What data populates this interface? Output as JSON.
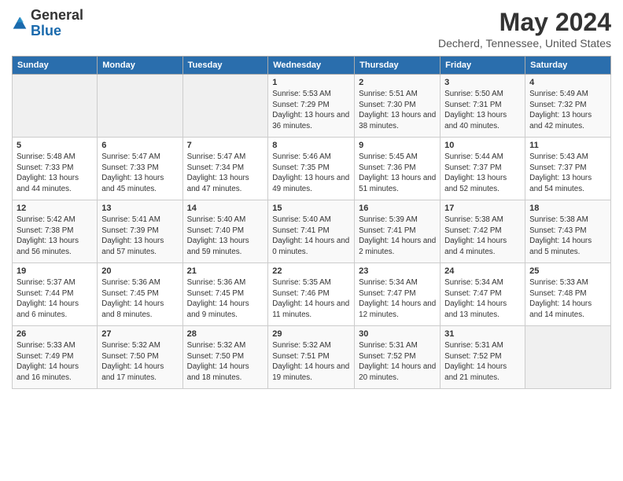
{
  "logo": {
    "general": "General",
    "blue": "Blue"
  },
  "header": {
    "month": "May 2024",
    "location": "Decherd, Tennessee, United States"
  },
  "days_of_week": [
    "Sunday",
    "Monday",
    "Tuesday",
    "Wednesday",
    "Thursday",
    "Friday",
    "Saturday"
  ],
  "weeks": [
    [
      {
        "day": "",
        "sunrise": "",
        "sunset": "",
        "daylight": ""
      },
      {
        "day": "",
        "sunrise": "",
        "sunset": "",
        "daylight": ""
      },
      {
        "day": "",
        "sunrise": "",
        "sunset": "",
        "daylight": ""
      },
      {
        "day": "1",
        "sunrise": "Sunrise: 5:53 AM",
        "sunset": "Sunset: 7:29 PM",
        "daylight": "Daylight: 13 hours and 36 minutes."
      },
      {
        "day": "2",
        "sunrise": "Sunrise: 5:51 AM",
        "sunset": "Sunset: 7:30 PM",
        "daylight": "Daylight: 13 hours and 38 minutes."
      },
      {
        "day": "3",
        "sunrise": "Sunrise: 5:50 AM",
        "sunset": "Sunset: 7:31 PM",
        "daylight": "Daylight: 13 hours and 40 minutes."
      },
      {
        "day": "4",
        "sunrise": "Sunrise: 5:49 AM",
        "sunset": "Sunset: 7:32 PM",
        "daylight": "Daylight: 13 hours and 42 minutes."
      }
    ],
    [
      {
        "day": "5",
        "sunrise": "Sunrise: 5:48 AM",
        "sunset": "Sunset: 7:33 PM",
        "daylight": "Daylight: 13 hours and 44 minutes."
      },
      {
        "day": "6",
        "sunrise": "Sunrise: 5:47 AM",
        "sunset": "Sunset: 7:33 PM",
        "daylight": "Daylight: 13 hours and 45 minutes."
      },
      {
        "day": "7",
        "sunrise": "Sunrise: 5:47 AM",
        "sunset": "Sunset: 7:34 PM",
        "daylight": "Daylight: 13 hours and 47 minutes."
      },
      {
        "day": "8",
        "sunrise": "Sunrise: 5:46 AM",
        "sunset": "Sunset: 7:35 PM",
        "daylight": "Daylight: 13 hours and 49 minutes."
      },
      {
        "day": "9",
        "sunrise": "Sunrise: 5:45 AM",
        "sunset": "Sunset: 7:36 PM",
        "daylight": "Daylight: 13 hours and 51 minutes."
      },
      {
        "day": "10",
        "sunrise": "Sunrise: 5:44 AM",
        "sunset": "Sunset: 7:37 PM",
        "daylight": "Daylight: 13 hours and 52 minutes."
      },
      {
        "day": "11",
        "sunrise": "Sunrise: 5:43 AM",
        "sunset": "Sunset: 7:37 PM",
        "daylight": "Daylight: 13 hours and 54 minutes."
      }
    ],
    [
      {
        "day": "12",
        "sunrise": "Sunrise: 5:42 AM",
        "sunset": "Sunset: 7:38 PM",
        "daylight": "Daylight: 13 hours and 56 minutes."
      },
      {
        "day": "13",
        "sunrise": "Sunrise: 5:41 AM",
        "sunset": "Sunset: 7:39 PM",
        "daylight": "Daylight: 13 hours and 57 minutes."
      },
      {
        "day": "14",
        "sunrise": "Sunrise: 5:40 AM",
        "sunset": "Sunset: 7:40 PM",
        "daylight": "Daylight: 13 hours and 59 minutes."
      },
      {
        "day": "15",
        "sunrise": "Sunrise: 5:40 AM",
        "sunset": "Sunset: 7:41 PM",
        "daylight": "Daylight: 14 hours and 0 minutes."
      },
      {
        "day": "16",
        "sunrise": "Sunrise: 5:39 AM",
        "sunset": "Sunset: 7:41 PM",
        "daylight": "Daylight: 14 hours and 2 minutes."
      },
      {
        "day": "17",
        "sunrise": "Sunrise: 5:38 AM",
        "sunset": "Sunset: 7:42 PM",
        "daylight": "Daylight: 14 hours and 4 minutes."
      },
      {
        "day": "18",
        "sunrise": "Sunrise: 5:38 AM",
        "sunset": "Sunset: 7:43 PM",
        "daylight": "Daylight: 14 hours and 5 minutes."
      }
    ],
    [
      {
        "day": "19",
        "sunrise": "Sunrise: 5:37 AM",
        "sunset": "Sunset: 7:44 PM",
        "daylight": "Daylight: 14 hours and 6 minutes."
      },
      {
        "day": "20",
        "sunrise": "Sunrise: 5:36 AM",
        "sunset": "Sunset: 7:45 PM",
        "daylight": "Daylight: 14 hours and 8 minutes."
      },
      {
        "day": "21",
        "sunrise": "Sunrise: 5:36 AM",
        "sunset": "Sunset: 7:45 PM",
        "daylight": "Daylight: 14 hours and 9 minutes."
      },
      {
        "day": "22",
        "sunrise": "Sunrise: 5:35 AM",
        "sunset": "Sunset: 7:46 PM",
        "daylight": "Daylight: 14 hours and 11 minutes."
      },
      {
        "day": "23",
        "sunrise": "Sunrise: 5:34 AM",
        "sunset": "Sunset: 7:47 PM",
        "daylight": "Daylight: 14 hours and 12 minutes."
      },
      {
        "day": "24",
        "sunrise": "Sunrise: 5:34 AM",
        "sunset": "Sunset: 7:47 PM",
        "daylight": "Daylight: 14 hours and 13 minutes."
      },
      {
        "day": "25",
        "sunrise": "Sunrise: 5:33 AM",
        "sunset": "Sunset: 7:48 PM",
        "daylight": "Daylight: 14 hours and 14 minutes."
      }
    ],
    [
      {
        "day": "26",
        "sunrise": "Sunrise: 5:33 AM",
        "sunset": "Sunset: 7:49 PM",
        "daylight": "Daylight: 14 hours and 16 minutes."
      },
      {
        "day": "27",
        "sunrise": "Sunrise: 5:32 AM",
        "sunset": "Sunset: 7:50 PM",
        "daylight": "Daylight: 14 hours and 17 minutes."
      },
      {
        "day": "28",
        "sunrise": "Sunrise: 5:32 AM",
        "sunset": "Sunset: 7:50 PM",
        "daylight": "Daylight: 14 hours and 18 minutes."
      },
      {
        "day": "29",
        "sunrise": "Sunrise: 5:32 AM",
        "sunset": "Sunset: 7:51 PM",
        "daylight": "Daylight: 14 hours and 19 minutes."
      },
      {
        "day": "30",
        "sunrise": "Sunrise: 5:31 AM",
        "sunset": "Sunset: 7:52 PM",
        "daylight": "Daylight: 14 hours and 20 minutes."
      },
      {
        "day": "31",
        "sunrise": "Sunrise: 5:31 AM",
        "sunset": "Sunset: 7:52 PM",
        "daylight": "Daylight: 14 hours and 21 minutes."
      },
      {
        "day": "",
        "sunrise": "",
        "sunset": "",
        "daylight": ""
      }
    ]
  ]
}
